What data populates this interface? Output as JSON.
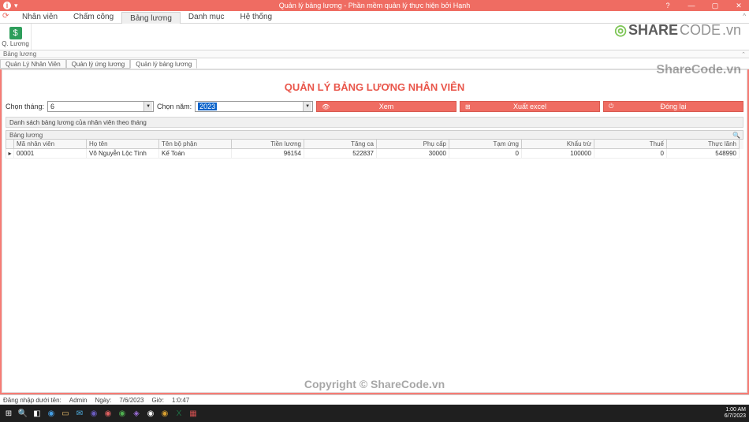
{
  "titlebar": {
    "title": "Quản lý bảng lương - Phần mềm quản lý thực hiện bởi Hạnh"
  },
  "menu": {
    "items": [
      "Nhân viên",
      "Chấm công",
      "Bảng lương",
      "Danh mục",
      "Hệ thống"
    ],
    "active_index": 2
  },
  "ribbon": {
    "group_icon": "$",
    "group_label": "Q. Lương",
    "caption": "Bảng lương"
  },
  "subtabs": {
    "items": [
      "Quản Lý Nhân Viên",
      "Quản lý ứng lương",
      "Quản lý bảng lương"
    ],
    "active_index": 2
  },
  "main": {
    "heading": "QUẢN LÝ BẢNG LƯƠNG NHÂN VIÊN",
    "label_month": "Chọn tháng:",
    "value_month": "6",
    "label_year": "Chọn năm:",
    "value_year": "2023",
    "btn_view": "Xem",
    "btn_export": "Xuất excel",
    "btn_close": "Đóng lại",
    "section_label": "Danh sách bảng lương của nhân viên theo tháng",
    "grid_caption": "Bảng lương"
  },
  "grid": {
    "columns": [
      "Mã nhân viên",
      "Họ tên",
      "Tên bộ phận",
      "Tiền lương",
      "Tăng ca",
      "Phụ cấp",
      "Tạm ứng",
      "Khẩu trừ",
      "Thuế",
      "Thực lãnh"
    ],
    "rows": [
      {
        "id": "00001",
        "name": "Võ Nguyễn Lộc Tình",
        "dept": "Kế Toán",
        "salary": "96154",
        "ot": "522837",
        "allow": "30000",
        "adv": "0",
        "ded": "100000",
        "tax": "0",
        "net": "548990"
      }
    ]
  },
  "statusbar": {
    "user_label": "Đăng nhập dưới tên:",
    "user": "Admin",
    "date_label": "Ngày:",
    "date": "7/6/2023",
    "time_label": "Giờ:",
    "time": "1:0:47"
  },
  "clock": {
    "time": "1:00 AM",
    "date": "6/7/2023"
  },
  "watermark": {
    "logo_main": "SHARE",
    "logo_sub": "CODE",
    "logo_tld": ".vn",
    "line2": "ShareCode.vn",
    "line3": "Copyright © ShareCode.vn"
  }
}
